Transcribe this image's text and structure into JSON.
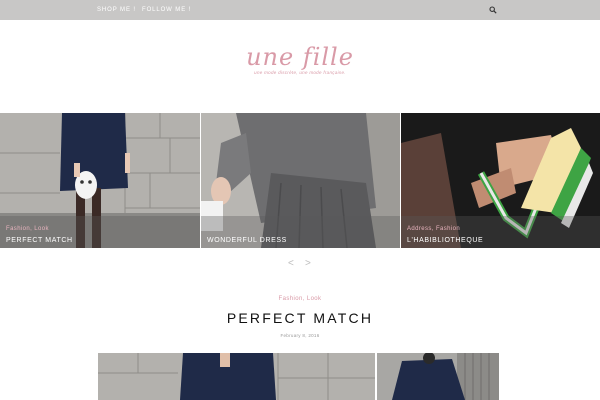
{
  "nav": {
    "shop_label": "SHOP ME !",
    "follow_label": "FOLLOW ME !"
  },
  "logo": {
    "title": "une fille",
    "tagline": "une mode discrète, une mode française."
  },
  "slides": [
    {
      "category": "Fashion, Look",
      "title": "PERFECT MATCH"
    },
    {
      "category": "",
      "title": "WONDERFUL DRESS"
    },
    {
      "category": "Address, Fashion",
      "title": "L'HABIBLIOTHEQUE"
    }
  ],
  "slider_nav": {
    "prev": "<",
    "next": ">"
  },
  "post": {
    "category": "Fashion, Look",
    "title": "PERFECT MATCH",
    "date": "February 8, 2016"
  },
  "colors": {
    "topbar": "#c8c7c6",
    "accent_pink": "#d99aa7"
  }
}
